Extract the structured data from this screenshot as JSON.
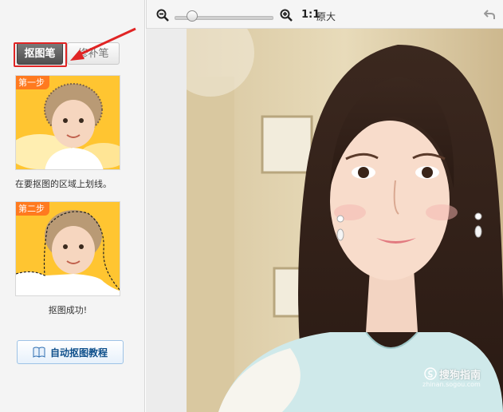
{
  "left_panel": {
    "tabs": [
      {
        "label": "抠图笔"
      },
      {
        "label": "修补笔"
      }
    ],
    "step1": {
      "badge": "第一步",
      "caption": "在要抠图的区域上划线。"
    },
    "step2": {
      "badge": "第二步",
      "caption": "抠图成功!"
    },
    "tutorial_button": {
      "label": "自动抠图教程"
    }
  },
  "toolbar": {
    "zoom_ratio": "1:1",
    "original_size_label": "原大",
    "zoom_slider_value": 0.18
  },
  "watermark": {
    "text": "搜狗指南",
    "sub": "zhinan.sogou.com"
  },
  "colors": {
    "accent_red": "#e02424",
    "step_badge": "#ff7a1f",
    "thumb_bg": "#ffc531"
  }
}
